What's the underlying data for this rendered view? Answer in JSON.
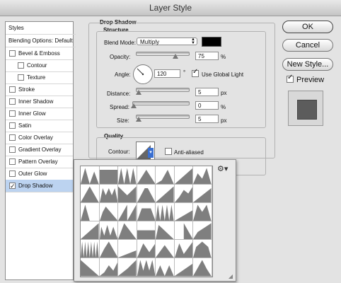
{
  "window": {
    "title": "Layer Style"
  },
  "styles_panel": {
    "header": "Styles",
    "blending": "Blending Options: Default",
    "items": [
      {
        "label": "Bevel & Emboss",
        "checked": false,
        "indent": false
      },
      {
        "label": "Contour",
        "checked": false,
        "indent": true
      },
      {
        "label": "Texture",
        "checked": false,
        "indent": true
      },
      {
        "label": "Stroke",
        "checked": false,
        "indent": false
      },
      {
        "label": "Inner Shadow",
        "checked": false,
        "indent": false
      },
      {
        "label": "Inner Glow",
        "checked": false,
        "indent": false
      },
      {
        "label": "Satin",
        "checked": false,
        "indent": false
      },
      {
        "label": "Color Overlay",
        "checked": false,
        "indent": false
      },
      {
        "label": "Gradient Overlay",
        "checked": false,
        "indent": false
      },
      {
        "label": "Pattern Overlay",
        "checked": false,
        "indent": false
      },
      {
        "label": "Outer Glow",
        "checked": false,
        "indent": false
      },
      {
        "label": "Drop Shadow",
        "checked": true,
        "indent": false,
        "selected": true
      }
    ]
  },
  "drop_shadow": {
    "title": "Drop Shadow",
    "structure_title": "Structure",
    "blend_mode_label": "Blend Mode:",
    "blend_mode_value": "Multiply",
    "shadow_color": "#000000",
    "opacity_label": "Opacity:",
    "opacity_value": "75",
    "opacity_unit": "%",
    "opacity_level": 0.75,
    "angle_label": "Angle:",
    "angle_value": "120",
    "angle_unit": "°",
    "use_global_light_label": "Use Global Light",
    "use_global_light": true,
    "distance_label": "Distance:",
    "distance_value": "5",
    "distance_unit": "px",
    "spread_label": "Spread:",
    "spread_value": "0",
    "spread_unit": "%",
    "size_label": "Size:",
    "size_value": "5",
    "size_unit": "px",
    "quality_title": "Quality",
    "contour_label": "Contour:",
    "anti_aliased_label": "Anti-aliased",
    "anti_aliased": false
  },
  "buttons": {
    "ok": "OK",
    "cancel": "Cancel",
    "new_style": "New Style...",
    "preview": "Preview"
  },
  "preview_checked": true,
  "contour_popup": {
    "icons": [
      "gear-icon",
      "resize-grip-icon"
    ]
  }
}
